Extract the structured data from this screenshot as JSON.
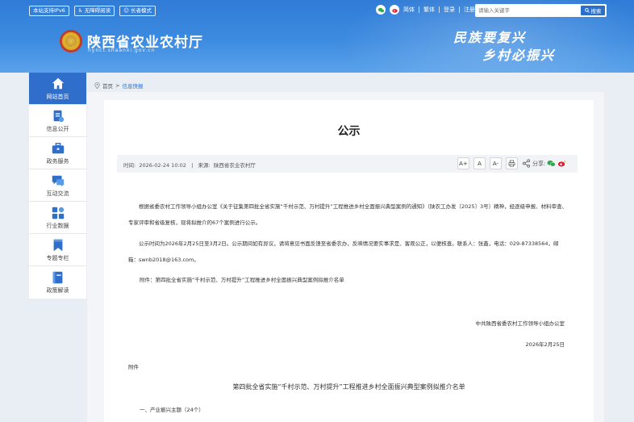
{
  "header": {
    "badges": [
      {
        "label": "本站支持IPv6"
      },
      {
        "label": "无障碍阅读"
      },
      {
        "label": "长者模式"
      }
    ],
    "links": {
      "simplified": "简体",
      "traditional": "繁体",
      "login": "登录",
      "register": "注册"
    },
    "search": {
      "placeholder": "请输入关键字",
      "button": "搜索"
    },
    "site_title": "陕西省农业农村厅",
    "site_url": "nynct.shaanxi.gov.cn",
    "slogan_line1": "民族要复兴",
    "slogan_line2": "乡村必振兴"
  },
  "nav": {
    "items": [
      {
        "label": "网站首页",
        "icon": "home-icon"
      },
      {
        "label": "信息公开",
        "icon": "document-icon"
      },
      {
        "label": "政务服务",
        "icon": "briefcase-icon"
      },
      {
        "label": "互动交流",
        "icon": "chat-icon"
      },
      {
        "label": "行业数据",
        "icon": "grid-icon"
      },
      {
        "label": "专题专栏",
        "icon": "bookmark-icon"
      },
      {
        "label": "政策解读",
        "icon": "book-icon"
      }
    ],
    "active_index": 0
  },
  "breadcrumb": {
    "home": "首页",
    "current": "信息快报"
  },
  "article": {
    "title": "公示",
    "time_label": "时间:",
    "time": "2026-02-24 10:02",
    "source_label": "来源:",
    "source": "陕西省农业农村厅",
    "font_buttons": [
      "A+",
      "A",
      "A-"
    ],
    "share_label": "分享:",
    "para1": "根据省委农村工作领导小组办公室《关于征集第四批全省实施“千村示范、万村提升”工程推进乡村全面振兴典型案例的通知》（陕农工办发〔2025〕3号）精神，经逐级申报、材料审查、专家评审和省级复核，现将拟推介的67个案例进行公示。",
    "para2": "公示时间为2026年2月25日至3月2日。公示期间如有异议，请将意见书面反馈至省委农办，反映情况要实事求是、客观公正，以便核查。联系人：张鑫，电话：029-87338564，邮箱：swnb2018@163.com。",
    "para3": "附件：第四批全省实施“千村示范、万村提升”工程推进乡村全面振兴典型案例拟推介名单",
    "signature": "中共陕西省委农村工作领导小组办公室",
    "date": "2026年2月25日",
    "attachment_label": "附件",
    "list_title": "第四批全省实施“千村示范、万村提升”工程推进乡村全面振兴典型案例拟推介名单",
    "category1": "一、产业振兴主题（24个）"
  },
  "colors": {
    "nav_active": "#2f6fcb",
    "header": "#3d8be0",
    "accent": "#2a6fc9"
  }
}
